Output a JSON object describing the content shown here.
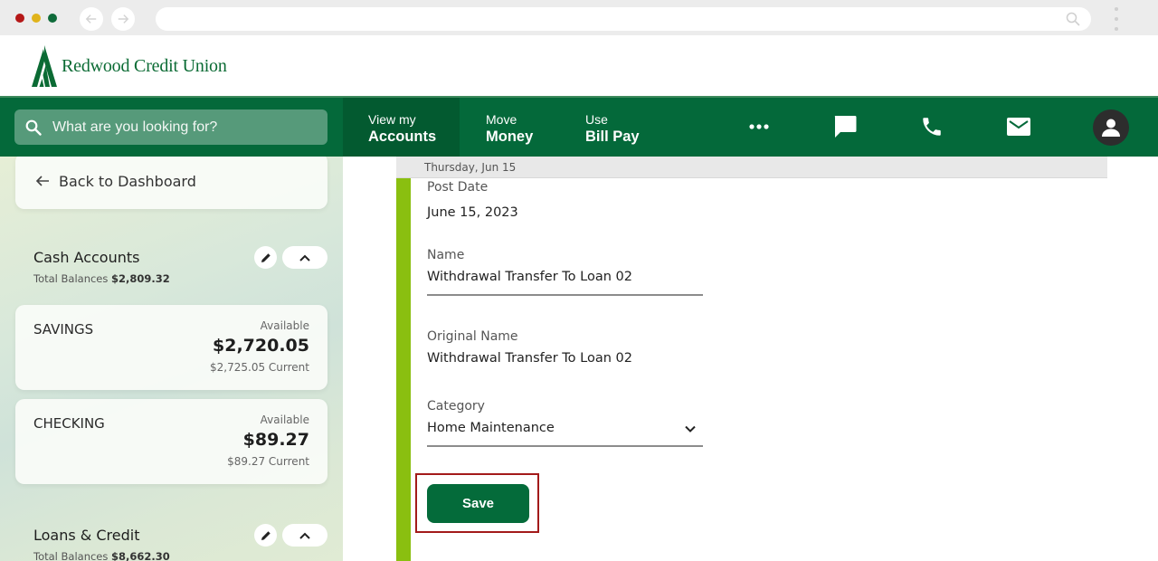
{
  "browser": {
    "window_controls": [
      "close",
      "minimize",
      "maximize"
    ],
    "back_icon": "arrow-left-icon",
    "forward_icon": "arrow-right-icon",
    "url": "",
    "search_icon": "search-icon",
    "menu_icon": "kebab-icon"
  },
  "brand": {
    "name": "Redwood Credit Union",
    "color": "#0b6b34"
  },
  "topnav": {
    "search_placeholder": "What are you looking for?",
    "items": [
      {
        "small": "View my",
        "big": "Accounts",
        "active": true
      },
      {
        "small": "Move",
        "big": "Money",
        "active": false
      },
      {
        "small": "Use",
        "big": "Bill Pay",
        "active": false
      }
    ],
    "icons": [
      "more-icon",
      "chat-icon",
      "phone-icon",
      "mail-icon",
      "profile-icon"
    ],
    "background": "#04693a"
  },
  "sidebar": {
    "back_label": "Back to Dashboard",
    "groups": [
      {
        "title": "Cash Accounts",
        "total_label": "Total Balances",
        "total_value": "$2,809.32",
        "accounts": [
          {
            "name": "SAVINGS",
            "available_label": "Available",
            "available": "$2,720.05",
            "current": "$2,725.05 Current"
          },
          {
            "name": "CHECKING",
            "available_label": "Available",
            "available": "$89.27",
            "current": "$89.27 Current"
          }
        ]
      },
      {
        "title": "Loans & Credit",
        "total_label": "Total Balances",
        "total_value": "$8,662.30"
      }
    ]
  },
  "main": {
    "date_header": "Thursday, Jun 15",
    "accent_color": "#8abf10",
    "fields": {
      "post_date": {
        "label": "Post Date",
        "value": "June 15, 2023"
      },
      "name": {
        "label": "Name",
        "value": "Withdrawal Transfer To Loan 02"
      },
      "original_name": {
        "label": "Original Name",
        "value": "Withdrawal Transfer To Loan 02"
      },
      "category": {
        "label": "Category",
        "value": "Home Maintenance"
      }
    },
    "save_label": "Save",
    "highlight_color": "#a31a1a"
  }
}
